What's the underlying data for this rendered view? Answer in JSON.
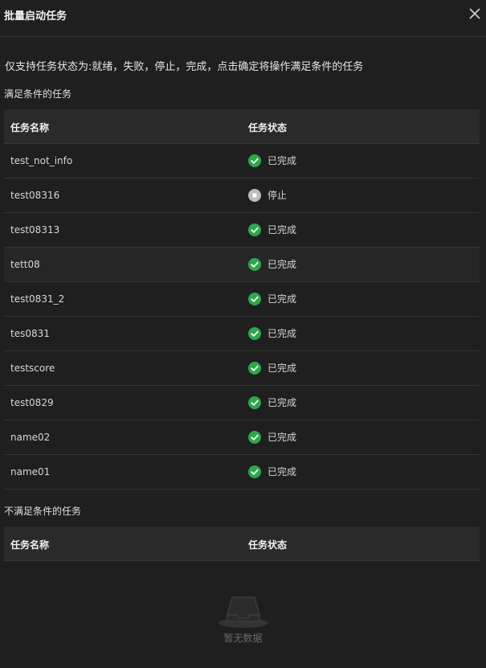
{
  "dialog": {
    "title": "批量启动任务",
    "close_icon": "close-icon",
    "description": "仅支持任务状态为:就绪，失败，停止，完成，点击确定将操作满足条件的任务"
  },
  "qualified": {
    "label": "满足条件的任务",
    "columns": [
      "任务名称",
      "任务状态"
    ],
    "rows": [
      {
        "name": "test_not_info",
        "status": "已完成",
        "status_icon": "check-circle-icon"
      },
      {
        "name": "test08316",
        "status": "停止",
        "status_icon": "stop-circle-icon"
      },
      {
        "name": "test08313",
        "status": "已完成",
        "status_icon": "check-circle-icon"
      },
      {
        "name": "tett08",
        "status": "已完成",
        "status_icon": "check-circle-icon"
      },
      {
        "name": "test0831_2",
        "status": "已完成",
        "status_icon": "check-circle-icon"
      },
      {
        "name": "tes0831",
        "status": "已完成",
        "status_icon": "check-circle-icon"
      },
      {
        "name": "testscore",
        "status": "已完成",
        "status_icon": "check-circle-icon"
      },
      {
        "name": "test0829",
        "status": "已完成",
        "status_icon": "check-circle-icon"
      },
      {
        "name": "name02",
        "status": "已完成",
        "status_icon": "check-circle-icon"
      },
      {
        "name": "name01",
        "status": "已完成",
        "status_icon": "check-circle-icon"
      }
    ]
  },
  "unqualified": {
    "label": "不满足条件的任务",
    "columns": [
      "任务名称",
      "任务状态"
    ],
    "empty_text": "暂无数据",
    "empty_icon": "empty-inbox-icon"
  },
  "colors": {
    "success": "#2ea64a",
    "stopped": "#bdbdbd",
    "background": "#1f1f1f"
  }
}
